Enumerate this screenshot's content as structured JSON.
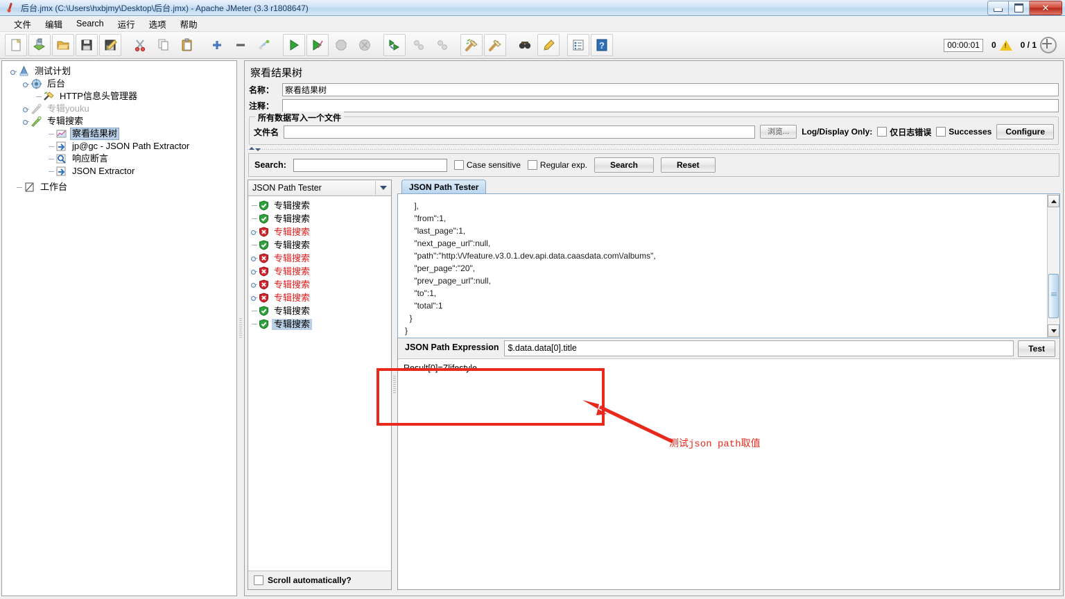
{
  "window": {
    "title": "后台.jmx (C:\\Users\\hxbjmy\\Desktop\\后台.jmx) - Apache JMeter (3.3 r1808647)",
    "icon": "jmeter-feather-icon",
    "minimize": "–",
    "maximize": "❐",
    "close": "✕"
  },
  "menubar": {
    "items": [
      {
        "label": "文件",
        "name": "menu-file"
      },
      {
        "label": "编辑",
        "name": "menu-edit"
      },
      {
        "label": "Search",
        "name": "menu-search"
      },
      {
        "label": "运行",
        "name": "menu-run"
      },
      {
        "label": "选项",
        "name": "menu-options"
      },
      {
        "label": "帮助",
        "name": "menu-help"
      }
    ]
  },
  "toolbar": {
    "buttons": [
      "new-icon",
      "templates-icon",
      "open-icon",
      "save-icon",
      "save-as-icon",
      "cut-icon",
      "copy-icon",
      "paste-icon",
      "expand-icon",
      "collapse-icon",
      "toggle-icon",
      "start-icon",
      "start-no-timers-icon",
      "stop-icon",
      "shutdown-icon",
      "start-remote-icon",
      "stop-remote-icon",
      "shutdown-remote-icon",
      "clear-icon",
      "clear-all-icon",
      "search-icon",
      "search-reset-icon",
      "function-helper-icon",
      "help-icon"
    ],
    "timer": "00:00:01",
    "warning_count": "0",
    "thread_count": "0 / 1",
    "reset_icon": "reset-gauge-icon"
  },
  "tree": {
    "nodes": [
      {
        "label": "测试计划",
        "indent": 0,
        "icon": "test-plan-icon",
        "handle": "knob",
        "state": "normal"
      },
      {
        "label": "后台",
        "indent": 1,
        "icon": "thread-group-icon",
        "handle": "knob",
        "state": "normal"
      },
      {
        "label": "HTTP信息头管理器",
        "indent": 2,
        "icon": "header-manager-icon",
        "handle": "tick",
        "state": "normal"
      },
      {
        "label": "专辑youku",
        "indent": 2,
        "icon": "http-sampler-disabled-icon",
        "handle": "knob",
        "state": "disabled"
      },
      {
        "label": "专辑搜索",
        "indent": 2,
        "icon": "http-sampler-icon",
        "handle": "knob",
        "state": "normal"
      },
      {
        "label": "察看结果树",
        "indent": 3,
        "icon": "view-results-tree-icon",
        "handle": "tick",
        "state": "selected"
      },
      {
        "label": "jp@gc - JSON Path Extractor",
        "indent": 3,
        "icon": "json-path-extractor-icon",
        "handle": "tick",
        "state": "normal"
      },
      {
        "label": "响应断言",
        "indent": 3,
        "icon": "response-assertion-icon",
        "handle": "tick",
        "state": "normal"
      },
      {
        "label": "JSON Extractor",
        "indent": 3,
        "icon": "json-extractor-icon",
        "handle": "tick",
        "state": "normal"
      },
      {
        "label": "工作台",
        "indent": 0,
        "icon": "workbench-icon",
        "handle": "tick",
        "state": "normal"
      }
    ]
  },
  "panel": {
    "title": "察看结果树",
    "name_label": "名称：",
    "name_value": "察看结果树",
    "comment_label": "注释：",
    "comment_value": "",
    "file_group_title": "所有数据写入一个文件",
    "filename_label": "文件名",
    "filename_value": "",
    "browse_button": "浏览...",
    "log_display_label": "Log/Display Only:",
    "errors_only_label": "仅日志错误",
    "successes_label": "Successes",
    "configure_button": "Configure"
  },
  "searchbar": {
    "label": "Search:",
    "value": "",
    "case_sensitive_label": "Case sensitive",
    "regular_exp_label": "Regular exp.",
    "search_button": "Search",
    "reset_button": "Reset"
  },
  "results": {
    "combo_selected": "JSON Path Tester",
    "items": [
      {
        "label": "专辑搜索",
        "status": "pass",
        "selected": false,
        "expandable": false
      },
      {
        "label": "专辑搜索",
        "status": "pass",
        "selected": false,
        "expandable": false
      },
      {
        "label": "专辑搜索",
        "status": "fail",
        "selected": false,
        "expandable": true
      },
      {
        "label": "专辑搜索",
        "status": "pass",
        "selected": false,
        "expandable": false
      },
      {
        "label": "专辑搜索",
        "status": "fail",
        "selected": false,
        "expandable": true
      },
      {
        "label": "专辑搜索",
        "status": "fail",
        "selected": false,
        "expandable": true
      },
      {
        "label": "专辑搜索",
        "status": "fail",
        "selected": false,
        "expandable": true
      },
      {
        "label": "专辑搜索",
        "status": "fail",
        "selected": false,
        "expandable": true
      },
      {
        "label": "专辑搜索",
        "status": "pass",
        "selected": false,
        "expandable": false
      },
      {
        "label": "专辑搜索",
        "status": "pass",
        "selected": true,
        "expandable": false
      }
    ],
    "scroll_auto_label": "Scroll automatically?"
  },
  "detail": {
    "tab_label": "JSON Path Tester",
    "json_body": "    ],\n    \"from\":1,\n    \"last_page\":1,\n    \"next_page_url\":null,\n    \"path\":\"http:\\/\\/feature.v3.0.1.dev.api.data.caasdata.com\\/albums\",\n    \"per_page\":\"20\",\n    \"prev_page_url\":null,\n    \"to\":1,\n    \"total\":1\n  }\n}",
    "expression_label": "JSON Path Expression",
    "expression_value": "$.data.data[0].title",
    "test_button": "Test",
    "result_text": "Result[0]=Zlifestyle"
  },
  "annotation": {
    "text": "测试json path取值",
    "color": "#e8291c"
  },
  "colors": {
    "accent": "#b8cfe5",
    "fail": "#e01b1b",
    "pass": "#2a9a3c",
    "annotation": "#e8291c",
    "titlebar": "#cfe2f5"
  }
}
